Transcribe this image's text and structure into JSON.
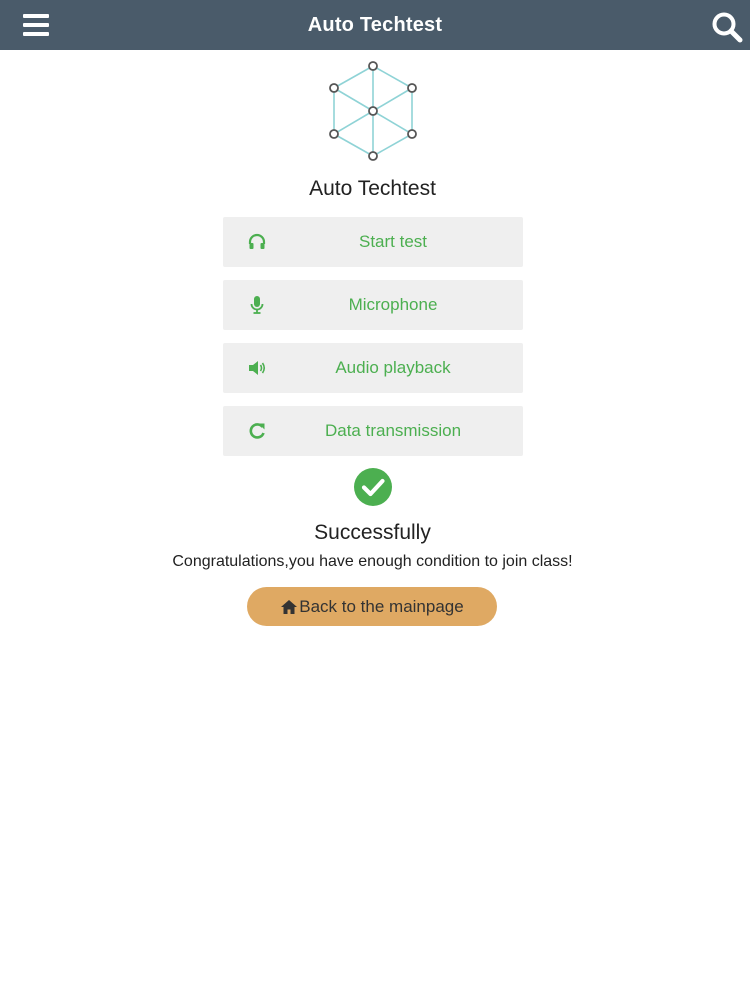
{
  "header": {
    "title": "Auto Techtest",
    "menu_icon": "hamburger-menu-icon",
    "search_icon": "search-icon",
    "background_color": "#4a5b6a"
  },
  "main": {
    "logo_icon": "network-cube-logo",
    "heading": "Auto Techtest",
    "tests": [
      {
        "label": "Start test",
        "icon": "headphones-icon"
      },
      {
        "label": "Microphone",
        "icon": "microphone-icon"
      },
      {
        "label": "Audio playback",
        "icon": "speaker-volume-icon"
      },
      {
        "label": "Data transmission",
        "icon": "refresh-icon"
      }
    ],
    "test_label_color": "#4caf50",
    "result": {
      "icon": "check-circle-icon",
      "title": "Successfully",
      "message": "Congratulations,you have enough condition to join class!"
    },
    "back_button": {
      "label": "Back to the mainpage",
      "icon": "home-icon",
      "color": "#dfa963"
    }
  }
}
